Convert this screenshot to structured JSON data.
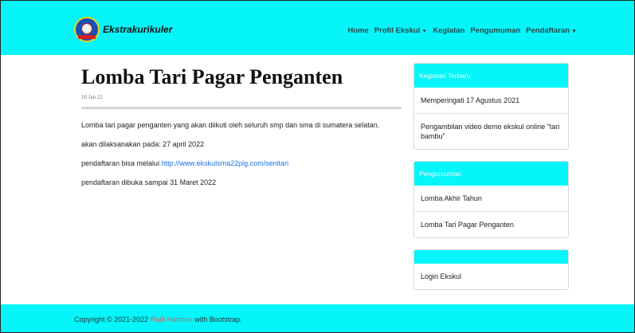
{
  "navbar": {
    "brand": "Ekstrakurikuler",
    "items": [
      {
        "label": "Home",
        "dropdown": false
      },
      {
        "label": "Profil Ekskul",
        "dropdown": true
      },
      {
        "label": "Kegiatan",
        "dropdown": false
      },
      {
        "label": "Pengumuman",
        "dropdown": false
      },
      {
        "label": "Pendaftaran",
        "dropdown": true
      }
    ]
  },
  "post": {
    "title": "Lomba Tari Pagar Penganten",
    "date": "18 Jan 22",
    "paragraphs": [
      "Lomba tari pagar penganten yang akan diikuti oleh seluruh smp dan sma di sumatera selatan.",
      "akan dilaksanakan pada: 27 april 2022"
    ],
    "registration_prefix": "pendaftaran bisa melalui ",
    "registration_link": "http://www.ekskulsma22plg.com/senitari",
    "deadline": "pendaftaran dibuka sampai 31 Maret 2022"
  },
  "sidebar": {
    "kegiatan": {
      "title": "Kegiatan Terbaru",
      "items": [
        "Memperingati 17 Agustus 2021",
        "Pengambilan video demo ekskul online \"tari bambu\""
      ]
    },
    "pengumuman": {
      "title": "Pengumuman",
      "items": [
        "Lomba Akhir Tahun",
        "Lomba Tari Pagar Penganten"
      ]
    },
    "login": {
      "title": "",
      "items": [
        "Login Ekskul"
      ]
    }
  },
  "footer": {
    "prefix": "Copyright © 2021-2022 ",
    "author": "Rudi Hartono",
    "suffix": " with Bootstrap."
  },
  "colors": {
    "accent": "#05f5fa",
    "link": "#1a73e8",
    "footer_link": "#e85a5a"
  },
  "icons": {
    "logo": "school-emblem-icon",
    "caret": "caret-down-icon"
  }
}
